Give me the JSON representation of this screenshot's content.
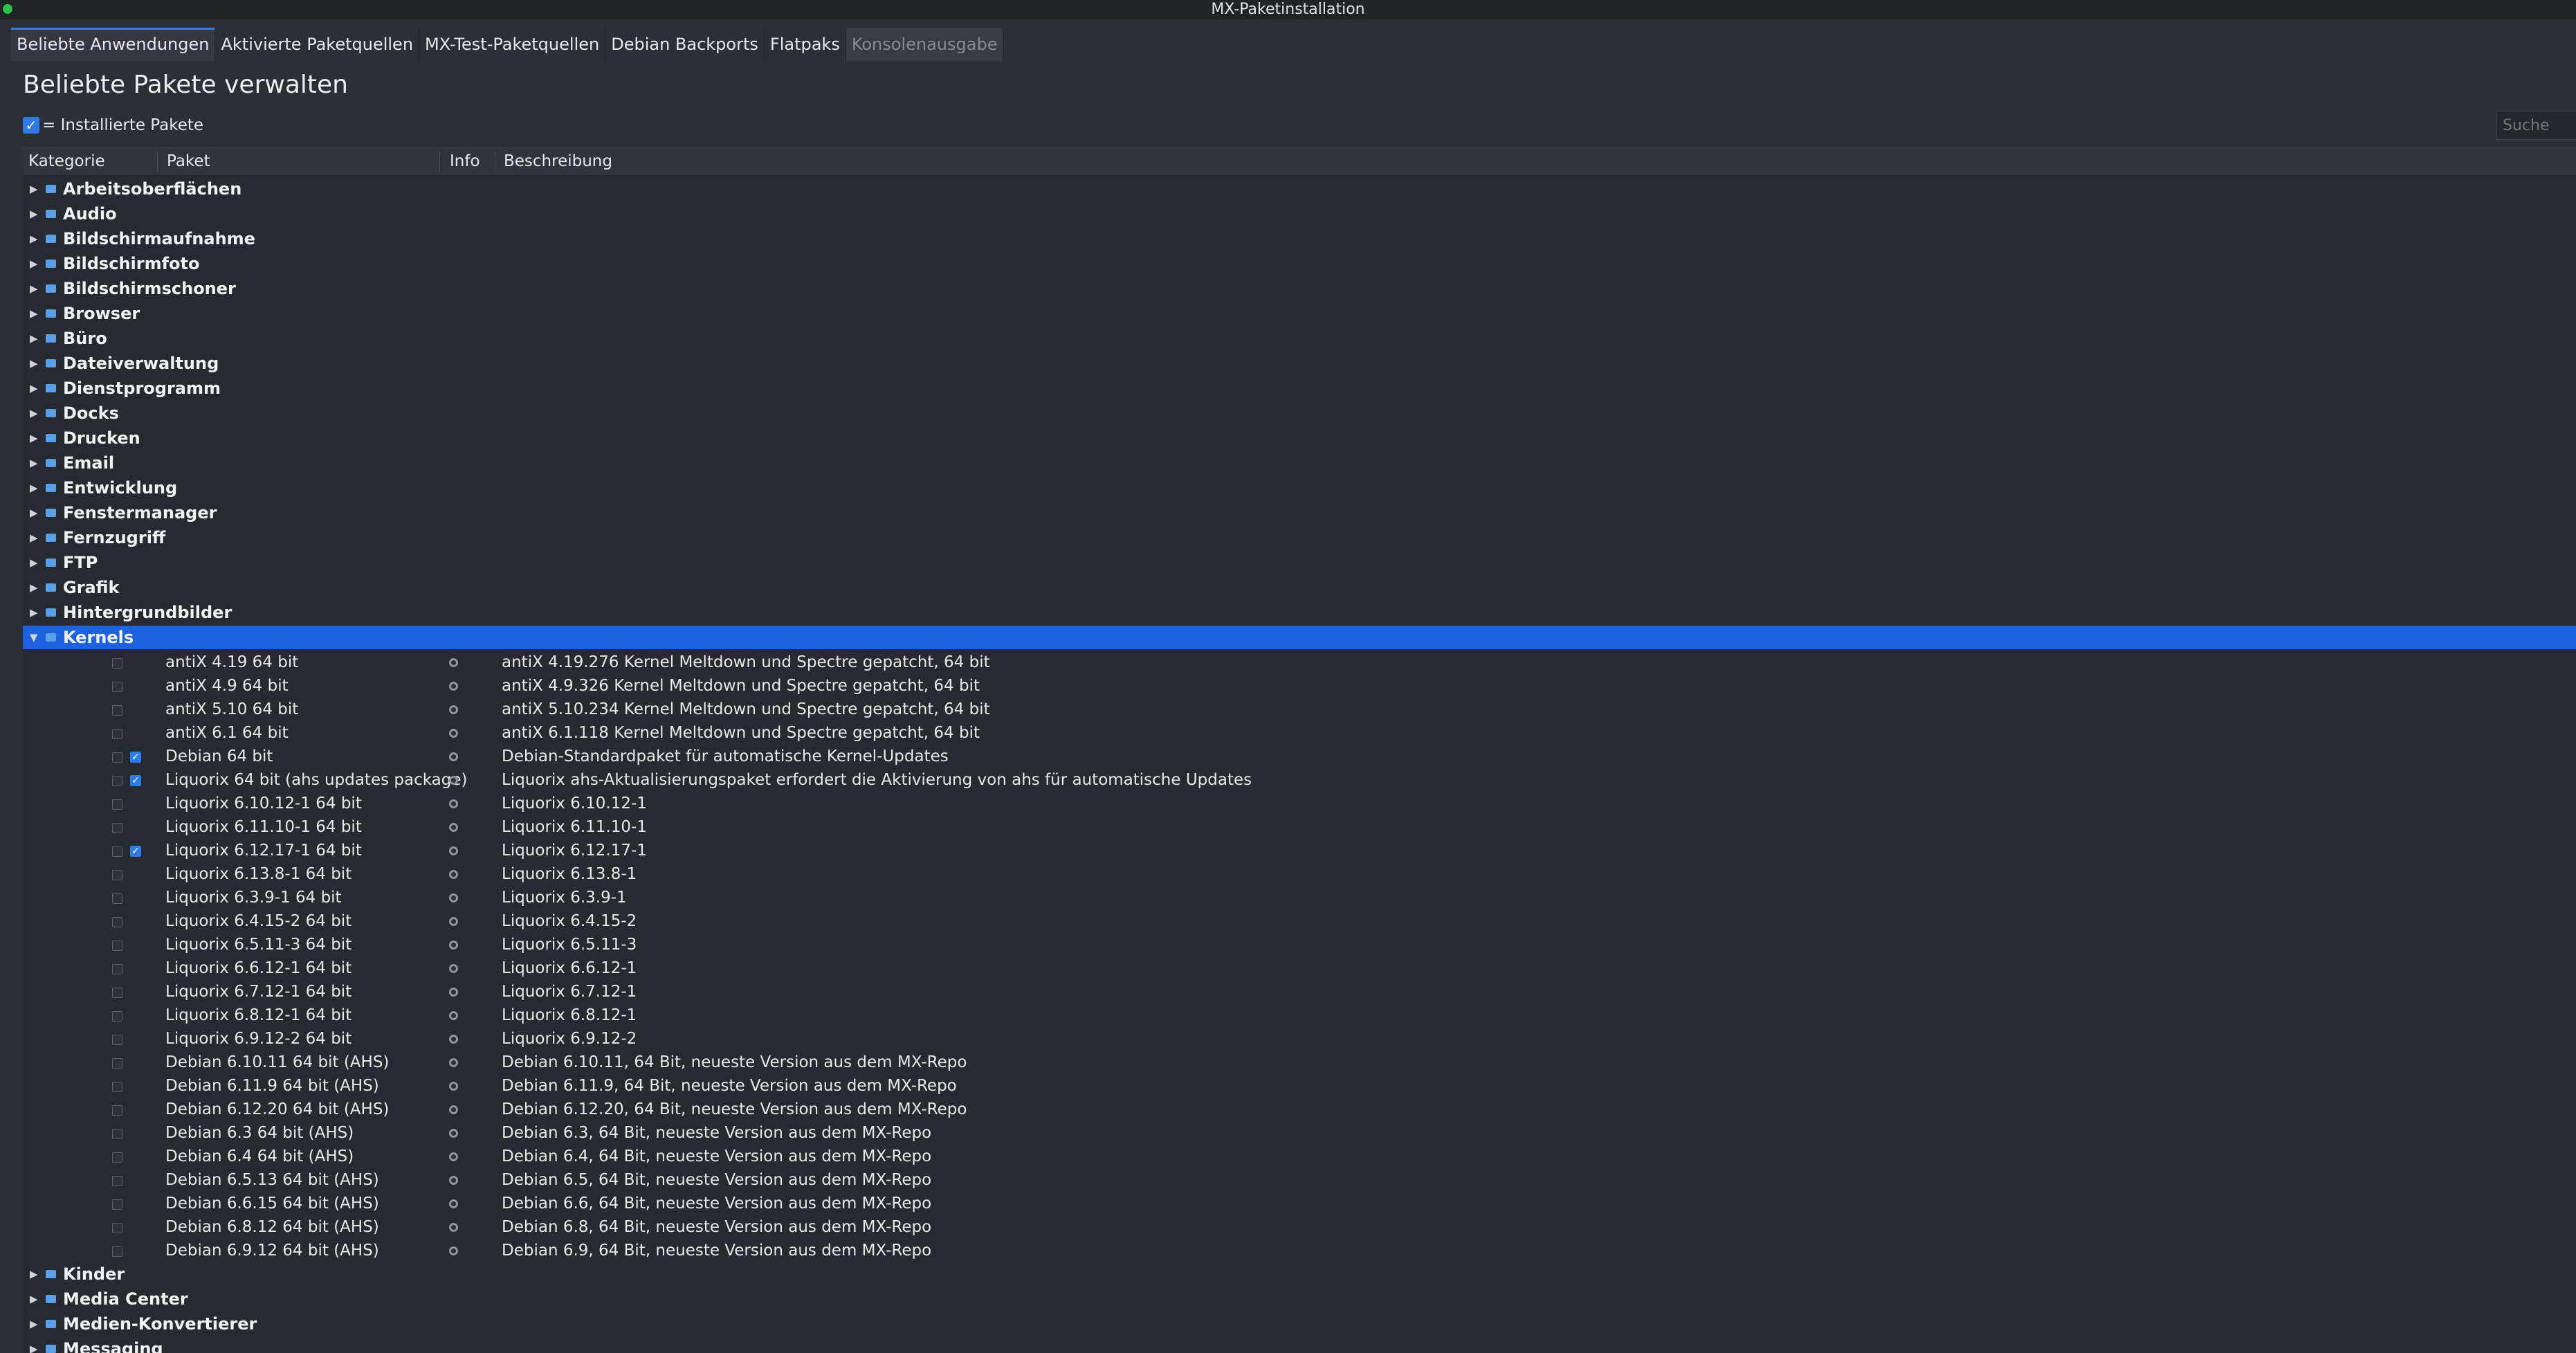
{
  "window": {
    "title": "MX-Paketinstallation"
  },
  "tabs": [
    {
      "label": "Beliebte Anwendungen",
      "state": "active"
    },
    {
      "label": "Aktivierte Paketquellen",
      "state": "normal"
    },
    {
      "label": "MX-Test-Paketquellen",
      "state": "normal"
    },
    {
      "label": "Debian Backports",
      "state": "normal"
    },
    {
      "label": "Flatpaks",
      "state": "normal"
    },
    {
      "label": "Konsolenausgabe",
      "state": "disabled"
    }
  ],
  "page": {
    "title": "Beliebte Pakete verwalten",
    "legend_text": "= Installierte Pakete",
    "search_placeholder": "Suche"
  },
  "tree": {
    "columns": [
      "Kategorie",
      "Paket",
      "Info",
      "Beschreibung"
    ],
    "categories_before": [
      "Arbeitsoberflächen",
      "Audio",
      "Bildschirmaufnahme",
      "Bildschirmfoto",
      "Bildschirmschoner",
      "Browser",
      "Büro",
      "Dateiverwaltung",
      "Dienstprogramm",
      "Docks",
      "Drucken",
      "Email",
      "Entwicklung",
      "Fenstermanager",
      "Fernzugriff",
      "FTP",
      "Grafik",
      "Hintergrundbilder"
    ],
    "expanded_category": "Kernels",
    "packages": [
      {
        "name": "antiX 4.19 64 bit",
        "desc": "antiX 4.19.276 Kernel Meltdown und Spectre gepatcht, 64 bit",
        "installed": false
      },
      {
        "name": "antiX 4.9 64 bit",
        "desc": "antiX 4.9.326 Kernel Meltdown und Spectre gepatcht, 64 bit",
        "installed": false
      },
      {
        "name": "antiX 5.10 64 bit",
        "desc": "antiX 5.10.234 Kernel Meltdown und Spectre gepatcht, 64 bit",
        "installed": false
      },
      {
        "name": "antiX 6.1 64 bit",
        "desc": "antiX 6.1.118 Kernel Meltdown und Spectre gepatcht, 64 bit",
        "installed": false
      },
      {
        "name": "Debian 64 bit",
        "desc": "Debian-Standardpaket für automatische Kernel-Updates",
        "installed": true
      },
      {
        "name": "Liquorix 64 bit (ahs updates package)",
        "desc": "Liquorix ahs-Aktualisierungspaket erfordert die Aktivierung von ahs für automatische Updates",
        "installed": true
      },
      {
        "name": "Liquorix 6.10.12-1 64 bit",
        "desc": "Liquorix 6.10.12-1",
        "installed": false
      },
      {
        "name": "Liquorix 6.11.10-1 64 bit",
        "desc": "Liquorix 6.11.10-1",
        "installed": false
      },
      {
        "name": "Liquorix 6.12.17-1 64 bit",
        "desc": "Liquorix 6.12.17-1",
        "installed": true
      },
      {
        "name": "Liquorix 6.13.8-1 64 bit",
        "desc": "Liquorix 6.13.8-1",
        "installed": false
      },
      {
        "name": "Liquorix 6.3.9-1 64 bit",
        "desc": "Liquorix 6.3.9-1",
        "installed": false
      },
      {
        "name": "Liquorix 6.4.15-2 64 bit",
        "desc": "Liquorix 6.4.15-2",
        "installed": false
      },
      {
        "name": "Liquorix 6.5.11-3 64 bit",
        "desc": "Liquorix 6.5.11-3",
        "installed": false
      },
      {
        "name": "Liquorix 6.6.12-1 64 bit",
        "desc": "Liquorix 6.6.12-1",
        "installed": false
      },
      {
        "name": "Liquorix 6.7.12-1 64 bit",
        "desc": "Liquorix 6.7.12-1",
        "installed": false
      },
      {
        "name": "Liquorix 6.8.12-1 64 bit",
        "desc": "Liquorix 6.8.12-1",
        "installed": false
      },
      {
        "name": "Liquorix 6.9.12-2 64 bit",
        "desc": "Liquorix 6.9.12-2",
        "installed": false
      },
      {
        "name": "Debian 6.10.11 64 bit (AHS)",
        "desc": "Debian 6.10.11, 64 Bit, neueste Version aus dem MX-Repo",
        "installed": false
      },
      {
        "name": "Debian 6.11.9 64 bit (AHS)",
        "desc": "Debian 6.11.9, 64 Bit, neueste Version aus dem MX-Repo",
        "installed": false
      },
      {
        "name": "Debian 6.12.20 64 bit (AHS)",
        "desc": "Debian 6.12.20, 64 Bit, neueste Version aus dem MX-Repo",
        "installed": false
      },
      {
        "name": "Debian 6.3 64 bit (AHS)",
        "desc": "Debian 6.3, 64 Bit, neueste Version aus dem MX-Repo",
        "installed": false
      },
      {
        "name": "Debian 6.4 64 bit (AHS)",
        "desc": "Debian 6.4, 64 Bit, neueste Version aus dem MX-Repo",
        "installed": false
      },
      {
        "name": "Debian 6.5.13 64 bit (AHS)",
        "desc": "Debian 6.5, 64 Bit, neueste Version aus dem MX-Repo",
        "installed": false
      },
      {
        "name": "Debian 6.6.15 64 bit (AHS)",
        "desc": "Debian 6.6, 64 Bit, neueste Version aus dem MX-Repo",
        "installed": false
      },
      {
        "name": "Debian 6.8.12 64 bit (AHS)",
        "desc": "Debian 6.8, 64 Bit, neueste Version aus dem MX-Repo",
        "installed": false
      },
      {
        "name": "Debian 6.9.12 64 bit (AHS)",
        "desc": "Debian 6.9, 64 Bit, neueste Version aus dem MX-Repo",
        "installed": false
      }
    ],
    "categories_after": [
      "Kinder",
      "Media Center",
      "Medien-Konvertierer",
      "Messaging"
    ]
  },
  "colors": {
    "accent": "#2f7ae5",
    "selection": "#1f62e0",
    "background": "#2a3035",
    "text": "#e6e8ea"
  },
  "icons": {
    "collapsed": "triangle-right-icon",
    "expanded": "triangle-down-icon",
    "category": "folder-icon",
    "info": "info-icon",
    "installed": "check-icon"
  }
}
